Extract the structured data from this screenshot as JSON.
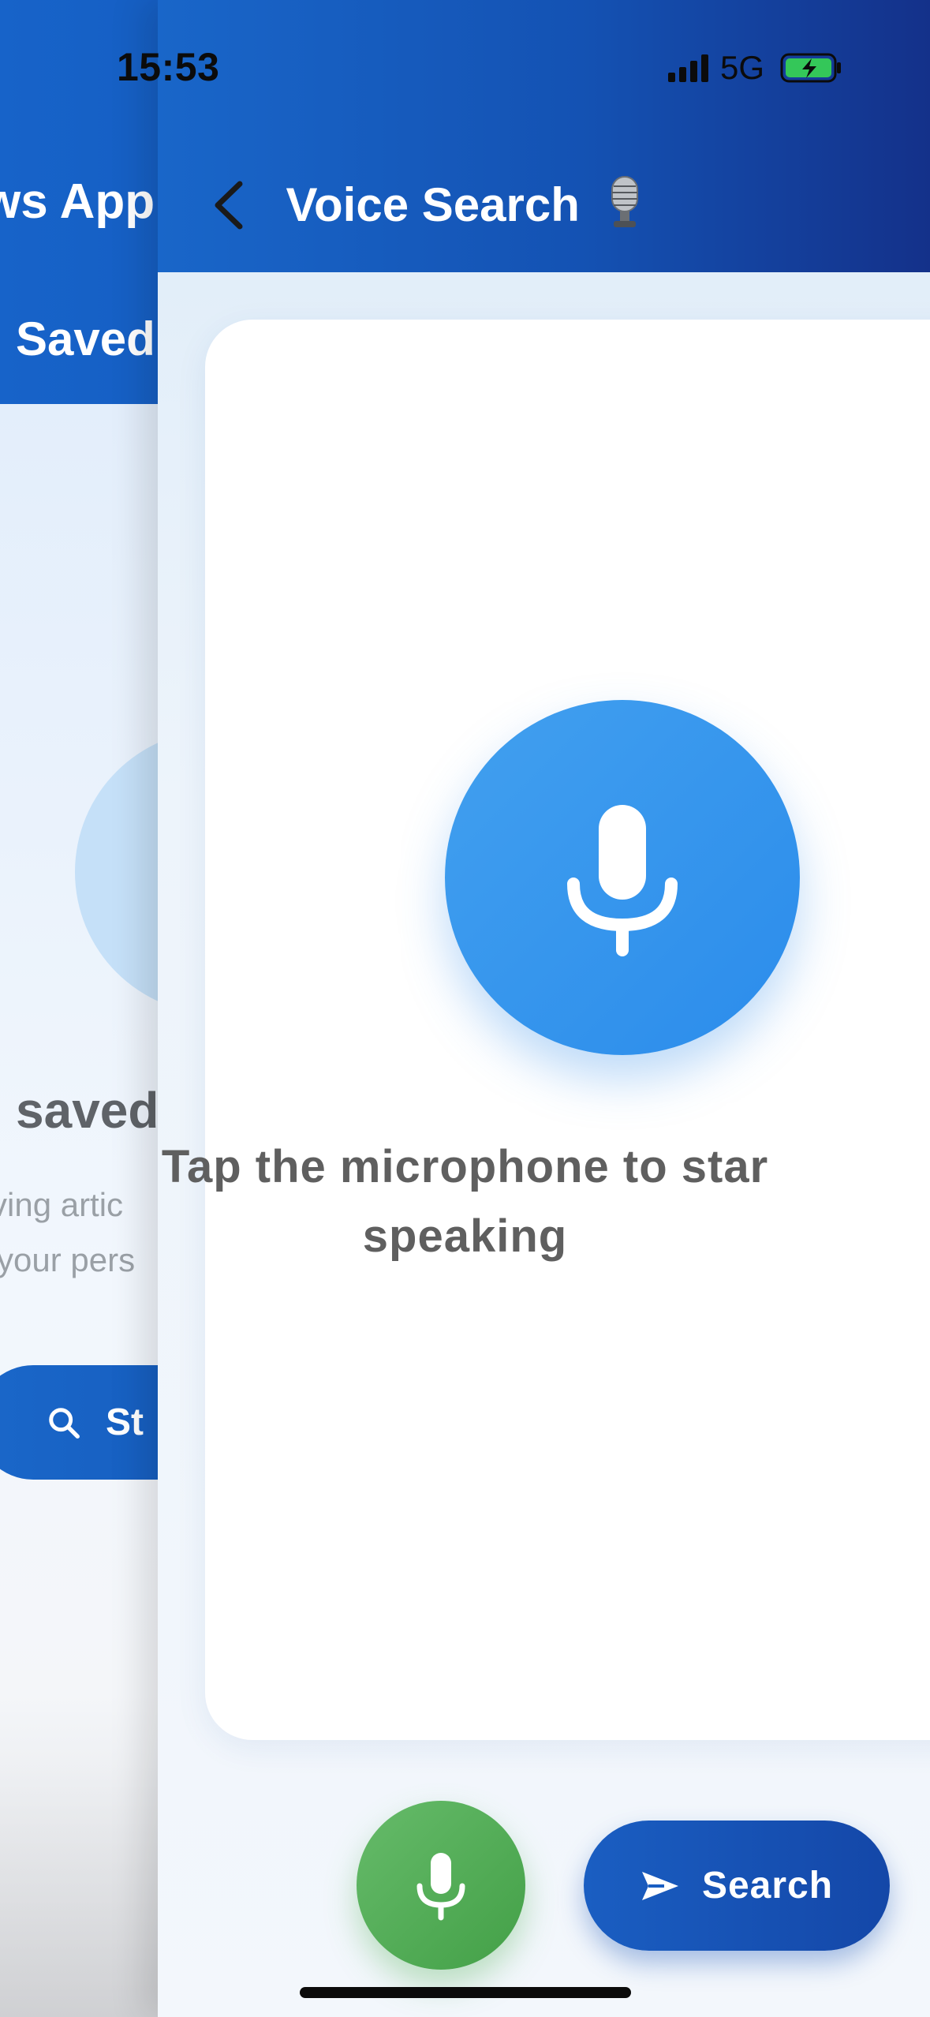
{
  "status_bar": {
    "time": "15:53",
    "network": "5G",
    "icons": [
      "signal-icon",
      "battery-charging-icon"
    ]
  },
  "background_screen": {
    "title_fragment": "ws App",
    "tab_fragment": "Saved",
    "empty_title_fragment": "saved",
    "empty_line1_fragment": "ving artic",
    "empty_line2_fragment": "your pers",
    "start_button_fragment": "St"
  },
  "app_bar": {
    "title": "Voice Search",
    "title_icon": "studio-microphone-emoji",
    "back_icon": "chevron-left-icon"
  },
  "main": {
    "prompt_line1": "Tap the microphone to star",
    "prompt_line2": "speaking",
    "mic_icon": "microphone-icon"
  },
  "bottom_actions": {
    "voice_button_icon": "microphone-icon",
    "search_label": "Search",
    "search_icon": "send-icon"
  },
  "colors": {
    "primary": "#1565C0",
    "mic_blue": "#3796EE",
    "fab_green": "#4CAF50",
    "prompt_text": "#5F5F5F"
  }
}
